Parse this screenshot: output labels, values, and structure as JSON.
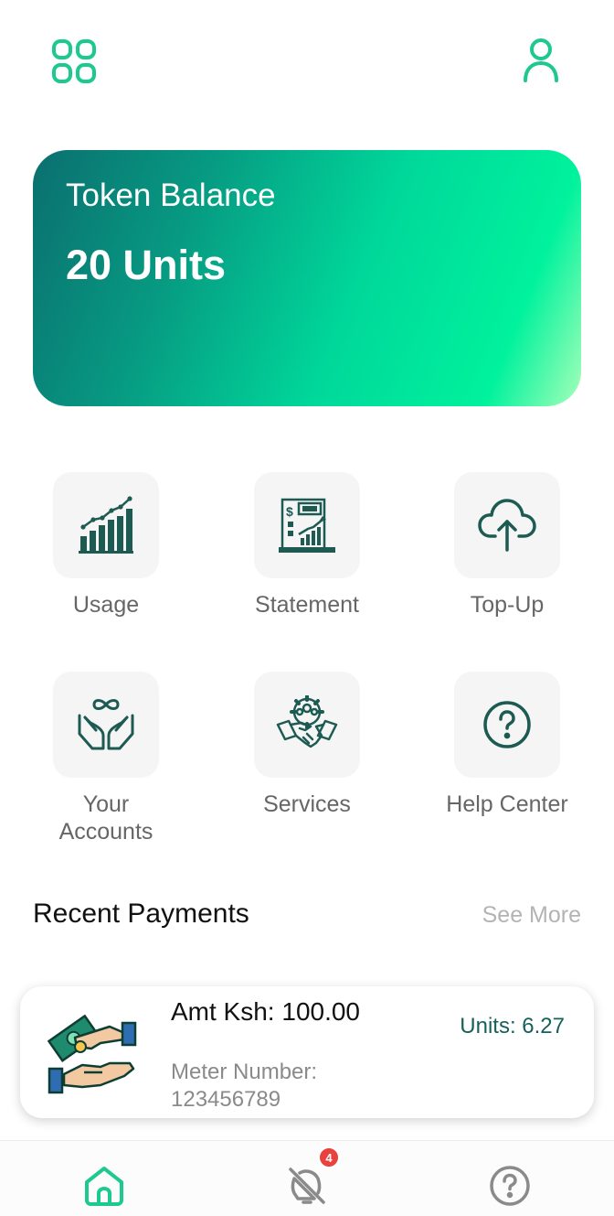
{
  "header": {
    "menu_icon": "grid-icon",
    "profile_icon": "user-icon"
  },
  "balance": {
    "label": "Token Balance",
    "value": "20 Units"
  },
  "tiles": [
    {
      "label": "Usage",
      "icon": "bar-chart-icon"
    },
    {
      "label": "Statement",
      "icon": "statement-icon"
    },
    {
      "label": "Top-Up",
      "icon": "cloud-upload-icon"
    },
    {
      "label": "Your Accounts",
      "icon": "hands-infinity-icon"
    },
    {
      "label": "Services",
      "icon": "handshake-icon"
    },
    {
      "label": "Help Center",
      "icon": "question-circle-icon"
    }
  ],
  "recent": {
    "title": "Recent Payments",
    "see_more": "See More",
    "payments": [
      {
        "amount": "Amt Ksh: 100.00",
        "meter_label": "Meter Number:",
        "meter_number": "123456789",
        "units": "Units: 6.27",
        "icon": "money-exchange-icon"
      }
    ]
  },
  "nav": {
    "items": [
      {
        "name": "home",
        "icon": "home-icon"
      },
      {
        "name": "alerts",
        "icon": "bell-off-icon",
        "badge": "4"
      },
      {
        "name": "help",
        "icon": "question-circle-icon"
      }
    ]
  },
  "colors": {
    "accent": "#1ec98e",
    "icon_dark": "#1d5b52",
    "badge": "#e9413d"
  }
}
